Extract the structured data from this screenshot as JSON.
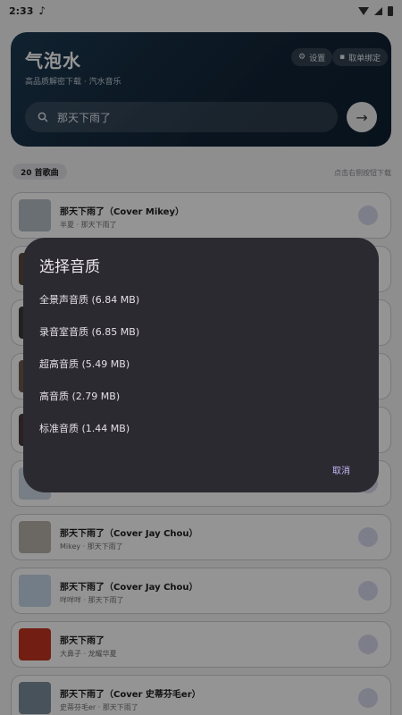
{
  "status": {
    "time": "2:33",
    "note_icon": "music-note-icon"
  },
  "header": {
    "title": "气泡水",
    "subtitle": "高品质解密下载 · 汽水音乐",
    "settings_label": "设置",
    "device_label": "取单绑定",
    "search_value": "那天下雨了"
  },
  "list": {
    "count_label": "20 首歌曲",
    "hint": "点击右侧按钮下载",
    "songs": [
      {
        "title": "那天下雨了（Cover Mikey）",
        "sub": "半夏 · 那天下雨了",
        "color": "#b7c0c9"
      },
      {
        "title": "",
        "sub": "",
        "color": "#5a4a3e"
      },
      {
        "title": "",
        "sub": "",
        "color": "#3a3a3a"
      },
      {
        "title": "",
        "sub": "",
        "color": "#6b5a4a"
      },
      {
        "title": "",
        "sub": "",
        "color": "#4a3a3a"
      },
      {
        "title": "",
        "sub": "",
        "color": "#cfd9e6"
      },
      {
        "title": "那天下雨了（Cover Jay Chou）",
        "sub": "Mikey · 那天下雨了",
        "color": "#b9b4ab"
      },
      {
        "title": "那天下雨了（Cover Jay Chou）",
        "sub": "咩咩咩 · 那天下雨了",
        "color": "#c6d8e8"
      },
      {
        "title": "那天下雨了",
        "sub": "大鼻子 · 龙耀华夏",
        "color": "#c4351f"
      },
      {
        "title": "那天下雨了（Cover 史蒂芬毛er）",
        "sub": "史蒂芬毛er · 那天下雨了",
        "color": "#7d8e9e"
      }
    ]
  },
  "dialog": {
    "title": "选择音质",
    "options": [
      "全景声音质 (6.84 MB)",
      "录音室音质 (6.85 MB)",
      "超高音质 (5.49 MB)",
      "高音质 (2.79 MB)",
      "标准音质 (1.44 MB)"
    ],
    "cancel": "取消"
  }
}
